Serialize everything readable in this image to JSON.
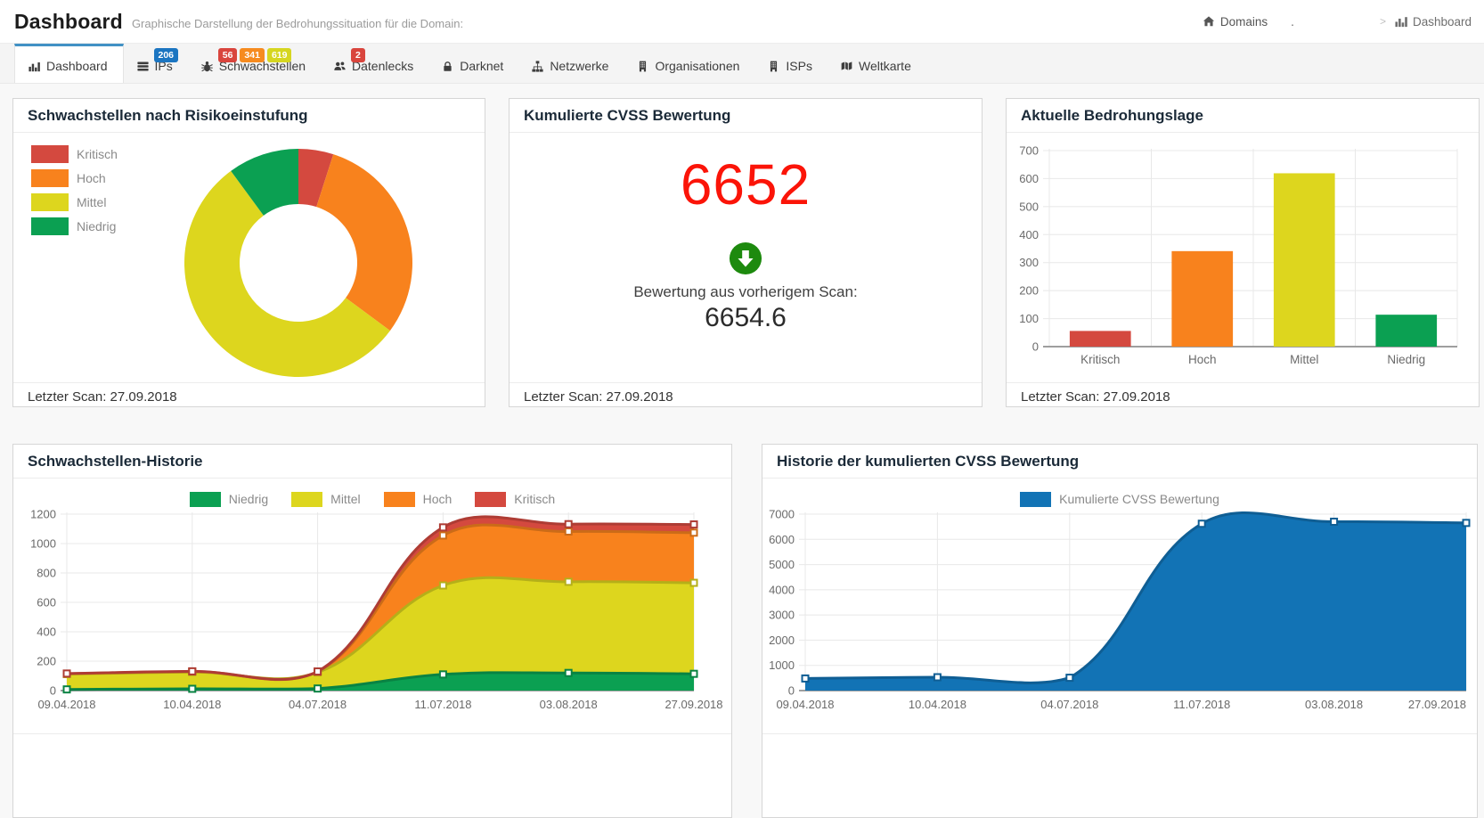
{
  "header": {
    "title": "Dashboard",
    "subtitle": "Graphische Darstellung der Bedrohungssituation für die Domain:",
    "breadcrumb": {
      "home_label": "Domains",
      "domain_text": ".",
      "separator": ">",
      "current_label": "Dashboard"
    }
  },
  "tabs": [
    {
      "label": "Dashboard",
      "icon": "bar-chart-icon",
      "active": true,
      "badges": []
    },
    {
      "label": "IPs",
      "icon": "server-icon",
      "active": false,
      "badges": [
        {
          "text": "206",
          "color": "#1b75c1"
        }
      ]
    },
    {
      "label": "Schwachstellen",
      "icon": "bug-icon",
      "active": false,
      "badges": [
        {
          "text": "56",
          "color": "#d9453d"
        },
        {
          "text": "341",
          "color": "#f68b1f"
        },
        {
          "text": "619",
          "color": "#d6d620"
        }
      ]
    },
    {
      "label": "Datenlecks",
      "icon": "users-icon",
      "active": false,
      "badges": [
        {
          "text": "2",
          "color": "#d9453d"
        }
      ]
    },
    {
      "label": "Darknet",
      "icon": "lock-icon",
      "active": false,
      "badges": []
    },
    {
      "label": "Netzwerke",
      "icon": "sitemap-icon",
      "active": false,
      "badges": []
    },
    {
      "label": "Organisationen",
      "icon": "building-icon",
      "active": false,
      "badges": []
    },
    {
      "label": "ISPs",
      "icon": "building-icon",
      "active": false,
      "badges": []
    },
    {
      "label": "Weltkarte",
      "icon": "map-icon",
      "active": false,
      "badges": []
    }
  ],
  "cards": {
    "risk_donut": {
      "title": "Schwachstellen nach Risikoeinstufung",
      "footer": "Letzter Scan: 27.09.2018"
    },
    "cvss": {
      "title": "Kumulierte CVSS Bewertung",
      "score": "6652",
      "trend_icon": "arrow-down-circle-icon",
      "previous_label": "Bewertung aus vorherigem Scan:",
      "previous_value": "6654.6",
      "footer": "Letzter Scan: 27.09.2018"
    },
    "current_threat": {
      "title": "Aktuelle Bedrohungslage",
      "footer": "Letzter Scan: 27.09.2018"
    },
    "vuln_history": {
      "title": "Schwachstellen-Historie"
    },
    "cvss_history": {
      "title": "Historie der kumulierten CVSS Bewertung"
    }
  },
  "colors": {
    "kritisch": "#d4493f",
    "hoch": "#f8821d",
    "mittel": "#ddd61e",
    "niedrig": "#0ba052",
    "series_blue": "#1273b5",
    "tab_accent": "#4191c5",
    "score_red": "#fb1408",
    "trend_green": "#1d8a0e"
  },
  "chart_data": [
    {
      "id": "risk_donut",
      "type": "pie",
      "donut": true,
      "labels": [
        "Kritisch",
        "Hoch",
        "Mittel",
        "Niedrig"
      ],
      "values": [
        56,
        341,
        619,
        114
      ],
      "colors": [
        "#d4493f",
        "#f8821d",
        "#ddd61e",
        "#0ba052"
      ],
      "legend_position": "left"
    },
    {
      "id": "current_threat",
      "type": "bar",
      "categories": [
        "Kritisch",
        "Hoch",
        "Mittel",
        "Niedrig"
      ],
      "values": [
        56,
        341,
        619,
        114
      ],
      "colors": [
        "#d4493f",
        "#f8821d",
        "#ddd61e",
        "#0ba052"
      ],
      "ylim": [
        0,
        700
      ],
      "ytick": 100,
      "grid": true
    },
    {
      "id": "vuln_history",
      "type": "area",
      "stacked": true,
      "x": [
        "09.04.2018",
        "10.04.2018",
        "04.07.2018",
        "11.07.2018",
        "03.08.2018",
        "27.09.2018"
      ],
      "series": [
        {
          "name": "Niedrig",
          "color": "#0ba052",
          "values": [
            8,
            12,
            14,
            110,
            120,
            114
          ]
        },
        {
          "name": "Mittel",
          "color": "#ddd61e",
          "values": [
            104,
            114,
            110,
            605,
            620,
            619
          ]
        },
        {
          "name": "Hoch",
          "color": "#f8821d",
          "values": [
            3,
            4,
            4,
            340,
            342,
            341
          ]
        },
        {
          "name": "Kritisch",
          "color": "#d4493f",
          "values": [
            1,
            1,
            2,
            55,
            50,
            56
          ]
        }
      ],
      "ylim": [
        0,
        1200
      ],
      "ytick": 200,
      "grid": true,
      "legend_position": "top"
    },
    {
      "id": "cvss_history",
      "type": "area",
      "stacked": false,
      "x": [
        "09.04.2018",
        "10.04.2018",
        "04.07.2018",
        "11.07.2018",
        "03.08.2018",
        "27.09.2018"
      ],
      "series": [
        {
          "name": "Kumulierte CVSS Bewertung",
          "color": "#1273b5",
          "values": [
            480,
            530,
            510,
            6620,
            6700,
            6652
          ]
        }
      ],
      "ylim": [
        0,
        7000
      ],
      "ytick": 1000,
      "grid": true,
      "legend_position": "top"
    }
  ]
}
